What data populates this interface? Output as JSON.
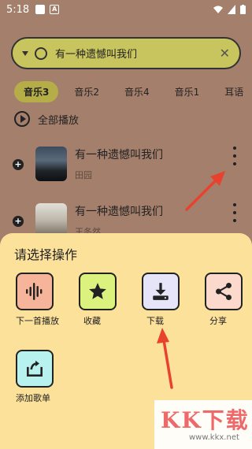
{
  "status_bar": {
    "time": "5:18"
  },
  "search": {
    "query": "有一种遗憾叫我们"
  },
  "tabs": [
    "音乐3",
    "音乐2",
    "音乐4",
    "音乐1",
    "耳语"
  ],
  "play_all_label": "全部播放",
  "songs": [
    {
      "title": "有一种遗憾叫我们",
      "artist": "田园"
    },
    {
      "title": "有一种遗憾叫我们",
      "artist": "王冬然"
    }
  ],
  "sheet": {
    "title": "请选择操作",
    "actions": [
      {
        "label": "下一首播放",
        "icon": "waveform-icon"
      },
      {
        "label": "收藏",
        "icon": "star-icon"
      },
      {
        "label": "下载",
        "icon": "download-icon"
      },
      {
        "label": "分享",
        "icon": "share-icon"
      },
      {
        "label": "添加歌单",
        "icon": "add-to-playlist-icon"
      }
    ]
  },
  "watermark": {
    "main": "KK下载",
    "sub": "www.kkx.net"
  },
  "colors": {
    "background": "#a47f6c",
    "search_bg": "#c8c45e",
    "tab_active": "#b5ad48",
    "sheet_bg": "#fce19a",
    "arrow": "#e8412e"
  }
}
